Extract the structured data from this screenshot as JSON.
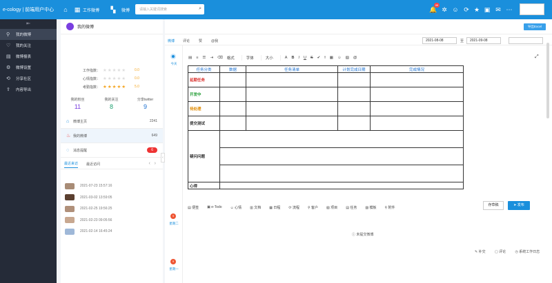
{
  "topbar": {
    "brand": "e-cology | 前端用户中心",
    "module": "工作微博",
    "search_scope": "微博",
    "search_placeholder": "请输入关键词搜索",
    "notification_count": "99"
  },
  "sidebar": {
    "items": [
      {
        "label": "我的微博",
        "active": true
      },
      {
        "label": "我的关注"
      },
      {
        "label": "微博报表"
      },
      {
        "label": "微博设置"
      },
      {
        "label": "分享社区"
      },
      {
        "label": "内容导出"
      }
    ]
  },
  "profile": {
    "header": "我的微博",
    "indexes": [
      {
        "label": "工作指数：",
        "value": "0.0"
      },
      {
        "label": "心情指数：",
        "value": "0.0"
      },
      {
        "label": "考勤指数：",
        "value": "5.0"
      }
    ],
    "stats": [
      {
        "label": "我的粉丝",
        "value": "11"
      },
      {
        "label": "我的关注",
        "value": "8"
      },
      {
        "label": "分享twitter",
        "value": "9"
      }
    ],
    "menu": [
      {
        "label": "微博主页",
        "count": "2241"
      },
      {
        "label": "我的微博",
        "count": "649"
      },
      {
        "label": "消息提醒",
        "count": "6"
      }
    ],
    "visitor_tabs": [
      "最近来访",
      "最近访问"
    ],
    "visitors": [
      "2021-07-23 15:57:16",
      "2021-03-02 13:59:05",
      "2021-02-25 19:56:25",
      "2021-02-23 09:05:56",
      "2021-02-14 16:45:24"
    ]
  },
  "main": {
    "export_label": "导出Excel",
    "tabs": [
      "微博",
      "评论",
      "赞",
      "@我"
    ],
    "date_from": "2021-08-08",
    "date_sep": "至",
    "date_to": "2021-09-08",
    "timeline": [
      {
        "label": "今天"
      },
      {
        "label": "星期二",
        "badge": "9"
      },
      {
        "label": "星期一",
        "badge": "9"
      }
    ],
    "toolbar": [
      "格式",
      "字体",
      "大小",
      "B",
      "I",
      "U",
      "S"
    ],
    "table_headers": [
      "任务分类",
      "数据",
      "任务清单",
      "计划完成日期",
      "完成情况"
    ],
    "rows": [
      {
        "label": "延期任务",
        "color": "#d9302c"
      },
      {
        "label": "开发中",
        "color": "#1f9b31"
      },
      {
        "label": "待处理",
        "color": "#e08a00"
      },
      {
        "label": "提交测试",
        "color": "#222222"
      },
      {
        "label": "疑问问题",
        "color": "#222222"
      },
      {
        "label": "心得",
        "color": "#222222"
      }
    ],
    "footer_tools": [
      "便签",
      "e-Todo",
      "心情",
      "文档",
      "日程",
      "流程",
      "客户",
      "项目",
      "任务",
      "模板",
      "附件"
    ],
    "draft_label": "存草稿",
    "publish_label": "发布",
    "empty_note": "未提交微博",
    "actions": [
      "补交",
      "评论",
      "系统工作日志"
    ]
  }
}
